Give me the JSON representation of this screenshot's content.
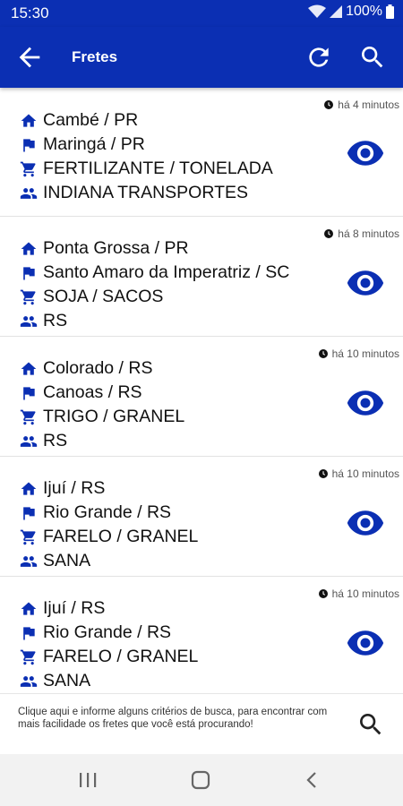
{
  "status_bar": {
    "time": "15:30",
    "battery": "100%"
  },
  "app_bar": {
    "title": "Fretes"
  },
  "colors": {
    "primary": "#0b2fb3",
    "icon": "#0b2fb3"
  },
  "freights": [
    {
      "time": "há 4 minutos",
      "origin": "Cambé / PR",
      "destination": "Maringá / PR",
      "product": "FERTILIZANTE / TONELADA",
      "company": "INDIANA TRANSPORTES"
    },
    {
      "time": "há 8 minutos",
      "origin": "Ponta Grossa / PR",
      "destination": "Santo Amaro da Imperatriz / SC",
      "product": "SOJA / SACOS",
      "company": "RS"
    },
    {
      "time": "há 10 minutos",
      "origin": "Colorado / RS",
      "destination": "Canoas / RS",
      "product": "TRIGO / GRANEL",
      "company": "RS"
    },
    {
      "time": "há 10 minutos",
      "origin": "Ijuí / RS",
      "destination": "Rio Grande / RS",
      "product": "FARELO / GRANEL",
      "company": "SANA"
    },
    {
      "time": "há 10 minutos",
      "origin": "Ijuí / RS",
      "destination": "Rio Grande / RS",
      "product": "FARELO / GRANEL",
      "company": "SANA"
    }
  ],
  "footer": {
    "message": "Clique aqui e informe alguns critérios de busca, para encontrar com mais facilidade os fretes que você está procurando!"
  },
  "icons": {
    "origin": "home-icon",
    "destination": "flag-icon",
    "product": "cart-icon",
    "company": "people-icon",
    "view": "eye-icon",
    "time": "clock-icon"
  }
}
